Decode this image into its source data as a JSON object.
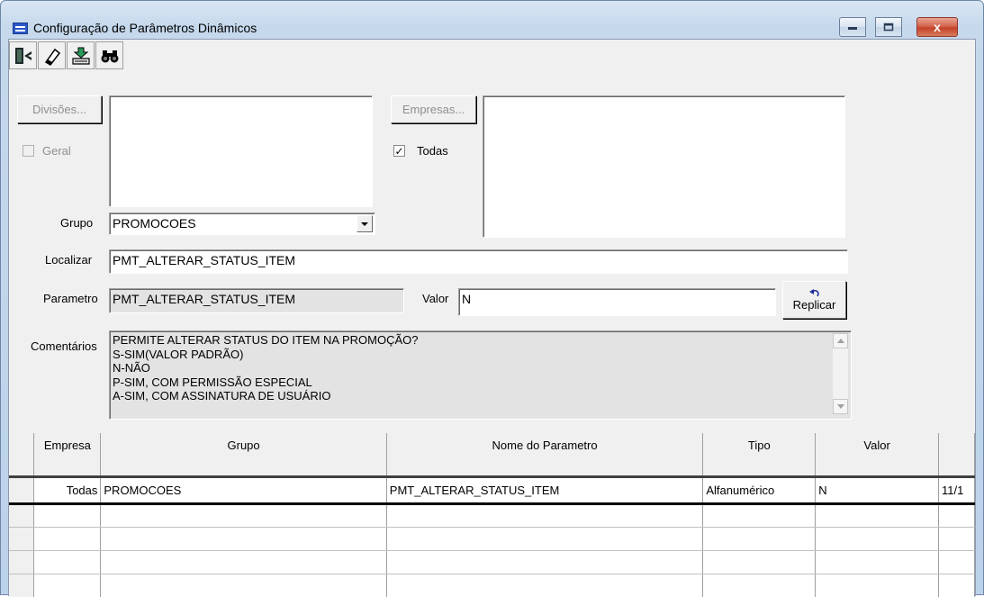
{
  "window": {
    "title": "Configuração de Parâmetros Dinâmicos",
    "controls": [
      "minimize",
      "maximize",
      "close"
    ],
    "close_glyph": "x"
  },
  "toolbar": {
    "buttons": [
      {
        "name": "exit-icon"
      },
      {
        "name": "eraser-icon"
      },
      {
        "name": "import-icon"
      },
      {
        "name": "binoculars-icon"
      }
    ]
  },
  "form": {
    "divisoes_button": "Divisões...",
    "geral_label": "Geral",
    "geral_checked": false,
    "empresas_button": "Empresas...",
    "todas_label": "Todas",
    "todas_checked": true,
    "check_glyph": "✓",
    "grupo_label": "Grupo",
    "grupo_value": "PROMOCOES",
    "localizar_label": "Localizar",
    "localizar_value": "PMT_ALTERAR_STATUS_ITEM",
    "parametro_label": "Parametro",
    "parametro_value": "PMT_ALTERAR_STATUS_ITEM",
    "valor_label": "Valor",
    "valor_value": "N",
    "replicar_label": "Replicar",
    "comentarios_label": "Comentários",
    "comentarios_text": "PERMITE ALTERAR STATUS DO ITEM NA PROMOÇÃO?\nS-SIM(VALOR PADRÃO)\nN-NÃO\nP-SIM, COM PERMISSÃO ESPECIAL\nA-SIM, COM ASSINATURA DE USUÁRIO"
  },
  "grid": {
    "columns": [
      "Empresa",
      "Grupo",
      "Nome do Parametro",
      "Tipo",
      "Valor",
      ""
    ],
    "rows": [
      [
        "Todas",
        "PROMOCOES",
        "PMT_ALTERAR_STATUS_ITEM",
        "Alfanumérico",
        "N",
        "11/1"
      ]
    ]
  },
  "colors": {
    "window_bg": "#f0f0f0",
    "title_bg": "#c5d8ec",
    "close_button": "#c4432a",
    "memo_bg": "#e3e3e3"
  }
}
